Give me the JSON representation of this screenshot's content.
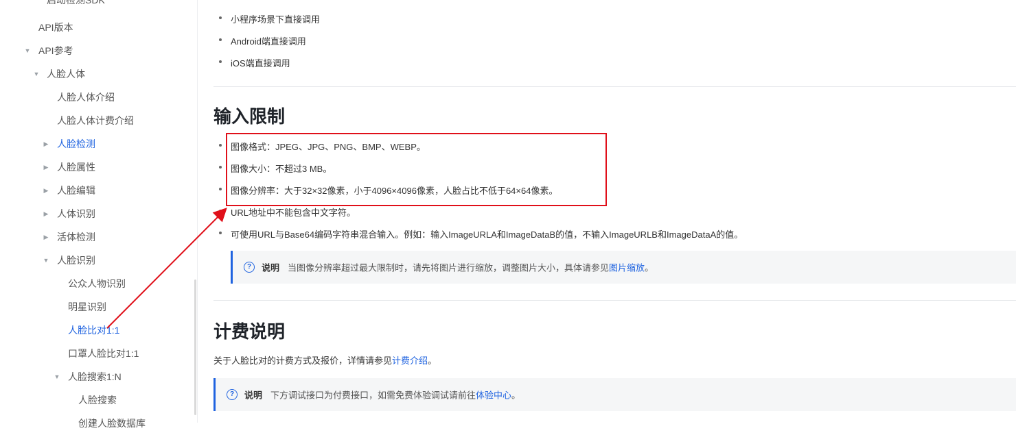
{
  "sidebar": {
    "items": [
      {
        "label": "启动检测SDK",
        "caret": "",
        "active": false
      },
      {
        "label": "API版本",
        "caret": "",
        "active": false
      },
      {
        "label": "API参考",
        "caret": "▼",
        "active": false
      },
      {
        "label": "人脸人体",
        "caret": "▼",
        "active": false
      },
      {
        "label": "人脸人体介绍",
        "caret": "",
        "active": false
      },
      {
        "label": "人脸人体计费介绍",
        "caret": "",
        "active": false
      },
      {
        "label": "人脸检测",
        "caret": "▶",
        "active": true
      },
      {
        "label": "人脸属性",
        "caret": "▶",
        "active": false
      },
      {
        "label": "人脸编辑",
        "caret": "▶",
        "active": false
      },
      {
        "label": "人体识别",
        "caret": "▶",
        "active": false
      },
      {
        "label": "活体检测",
        "caret": "▶",
        "active": false
      },
      {
        "label": "人脸识别",
        "caret": "▼",
        "active": false
      },
      {
        "label": "公众人物识别",
        "caret": "",
        "active": false
      },
      {
        "label": "明星识别",
        "caret": "",
        "active": false
      },
      {
        "label": "人脸比对1:1",
        "caret": "",
        "active": true
      },
      {
        "label": "口罩人脸比对1:1",
        "caret": "",
        "active": false
      },
      {
        "label": "人脸搜索1:N",
        "caret": "▼",
        "active": false
      },
      {
        "label": "人脸搜索",
        "caret": "",
        "active": false
      },
      {
        "label": "创建人脸数据库",
        "caret": "",
        "active": false
      }
    ]
  },
  "content": {
    "call_links": [
      "小程序场景下直接调用",
      "Android端直接调用",
      "iOS端直接调用"
    ],
    "section_input_title": "输入限制",
    "input_limits": [
      "图像格式：JPEG、JPG、PNG、BMP、WEBP。",
      "图像大小：不超过3 MB。",
      "图像分辨率：大于32×32像素，小于4096×4096像素，人脸占比不低于64×64像素。",
      "URL地址中不能包含中文字符。",
      "可使用URL与Base64编码字符串混合输入。例如：输入ImageURLA和ImageDataB的值，不输入ImageURLB和ImageDataA的值。"
    ],
    "note1": {
      "label": "说明",
      "text": "当图像分辨率超过最大限制时，请先将图片进行缩放，调整图片大小，具体请参见",
      "link": "图片缩放",
      "suffix": "。"
    },
    "section_billing_title": "计费说明",
    "billing_text": "关于人脸比对的计费方式及报价，详情请参见",
    "billing_link": "计费介绍",
    "billing_suffix": "。",
    "note2": {
      "label": "说明",
      "text": "下方调试接口为付费接口，如需免费体验调试请前往",
      "link": "体验中心",
      "suffix": "。"
    }
  },
  "colors": {
    "accent": "#1f63e0",
    "annotation": "#e0101a"
  }
}
